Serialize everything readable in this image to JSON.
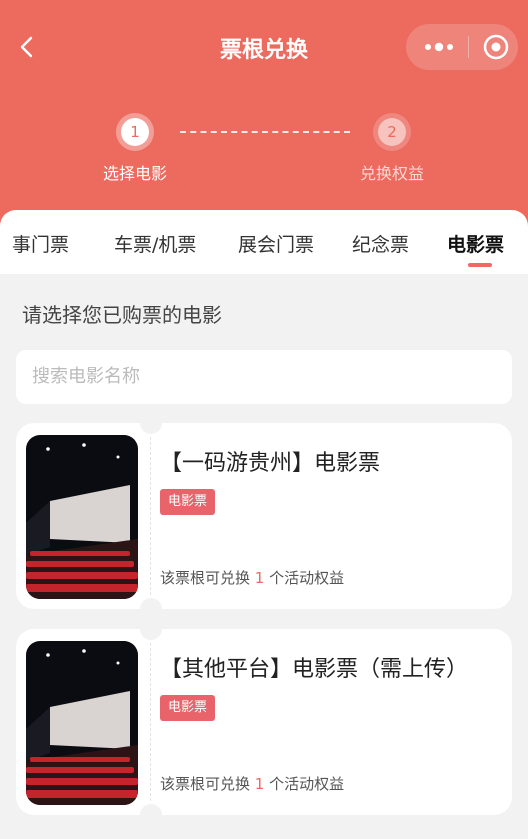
{
  "header": {
    "title": "票根兑换",
    "steps": [
      {
        "number": "1",
        "label": "选择电影"
      },
      {
        "number": "2",
        "label": "兑换权益"
      }
    ]
  },
  "tabs": [
    {
      "label": "赛事门票",
      "visible_text": "事门票"
    },
    {
      "label": "车票/机票"
    },
    {
      "label": "展会门票"
    },
    {
      "label": "纪念票"
    },
    {
      "label": "电影票",
      "active": true
    }
  ],
  "section_title": "请选择您已购票的电影",
  "search": {
    "placeholder": "搜索电影名称"
  },
  "cards": [
    {
      "title": "【一码游贵州】电影票",
      "badge": "电影票",
      "redeem_prefix": "该票根可兑换",
      "redeem_count": "1",
      "redeem_suffix": "个活动权益"
    },
    {
      "title": "【其他平台】电影票（需上传）",
      "badge": "电影票",
      "redeem_prefix": "该票根可兑换",
      "redeem_count": "1",
      "redeem_suffix": "个活动权益"
    }
  ],
  "colors": {
    "accent": "#ec6a5e",
    "badge": "#e9636b",
    "background": "#f2f2f2"
  },
  "icons": {
    "back": "chevron-left-icon",
    "more": "more-dots-icon",
    "close": "target-close-icon"
  }
}
